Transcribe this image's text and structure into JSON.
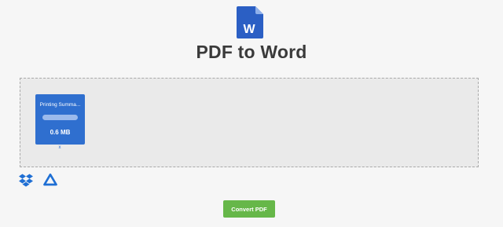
{
  "header": {
    "logo_icon": "word-document-icon",
    "logo_letter": "W",
    "title": "PDF to Word"
  },
  "file": {
    "name": "Printing Summa...",
    "size": "0.6 MB",
    "progress": 1.0,
    "remove_label": "x"
  },
  "cloud": {
    "dropbox_icon": "dropbox-icon",
    "drive_icon": "google-drive-icon"
  },
  "actions": {
    "convert_label": "Convert PDF"
  },
  "colors": {
    "word_blue": "#2b5fc4",
    "card_blue": "#2f6fcf",
    "convert_green": "#66b749",
    "title_text": "#3a3a3a"
  }
}
